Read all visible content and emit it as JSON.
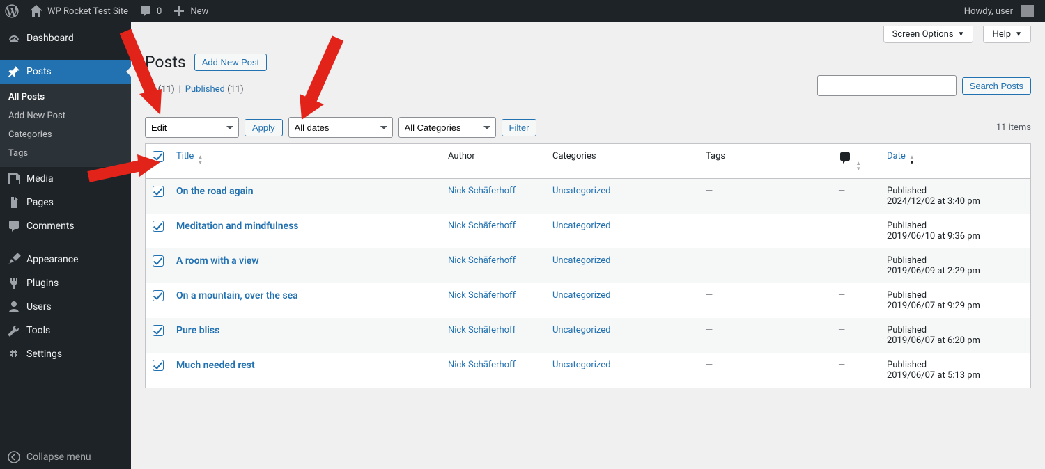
{
  "adminbar": {
    "site_title": "WP Rocket Test Site",
    "comments_count": "0",
    "new_label": "New",
    "howdy": "Howdy, user"
  },
  "sidebar": {
    "dashboard": "Dashboard",
    "posts": "Posts",
    "submenu": {
      "all_posts": "All Posts",
      "add_new": "Add New Post",
      "categories": "Categories",
      "tags": "Tags"
    },
    "media": "Media",
    "pages": "Pages",
    "comments": "Comments",
    "appearance": "Appearance",
    "plugins": "Plugins",
    "users": "Users",
    "tools": "Tools",
    "settings": "Settings",
    "collapse": "Collapse menu"
  },
  "screen_tabs": {
    "options": "Screen Options",
    "help": "Help"
  },
  "page": {
    "title": "Posts",
    "add_new": "Add New Post"
  },
  "filters": {
    "all_label": "All",
    "all_count": "(11)",
    "sep": "|",
    "published_label": "Published",
    "published_count": "(11)"
  },
  "search": {
    "button": "Search Posts"
  },
  "bulk": {
    "action": "Edit",
    "apply": "Apply",
    "dates": "All dates",
    "categories": "All Categories",
    "filter": "Filter"
  },
  "items_count": "11 items",
  "cols": {
    "title": "Title",
    "author": "Author",
    "categories": "Categories",
    "tags": "Tags",
    "date": "Date"
  },
  "published_word": "Published",
  "rows": [
    {
      "title": "On the road again",
      "author": "Nick Schäferhoff",
      "cat": "Uncategorized",
      "tags": "—",
      "com": "—",
      "date": "2024/12/02 at 3:40 pm"
    },
    {
      "title": "Meditation and mindfulness",
      "author": "Nick Schäferhoff",
      "cat": "Uncategorized",
      "tags": "—",
      "com": "—",
      "date": "2019/06/10 at 9:36 pm"
    },
    {
      "title": "A room with a view",
      "author": "Nick Schäferhoff",
      "cat": "Uncategorized",
      "tags": "—",
      "com": "—",
      "date": "2019/06/09 at 2:29 pm"
    },
    {
      "title": "On a mountain, over the sea",
      "author": "Nick Schäferhoff",
      "cat": "Uncategorized",
      "tags": "—",
      "com": "—",
      "date": "2019/06/07 at 9:29 pm"
    },
    {
      "title": "Pure bliss",
      "author": "Nick Schäferhoff",
      "cat": "Uncategorized",
      "tags": "—",
      "com": "—",
      "date": "2019/06/07 at 6:20 pm"
    },
    {
      "title": "Much needed rest",
      "author": "Nick Schäferhoff",
      "cat": "Uncategorized",
      "tags": "—",
      "com": "—",
      "date": "2019/06/07 at 5:13 pm"
    }
  ]
}
